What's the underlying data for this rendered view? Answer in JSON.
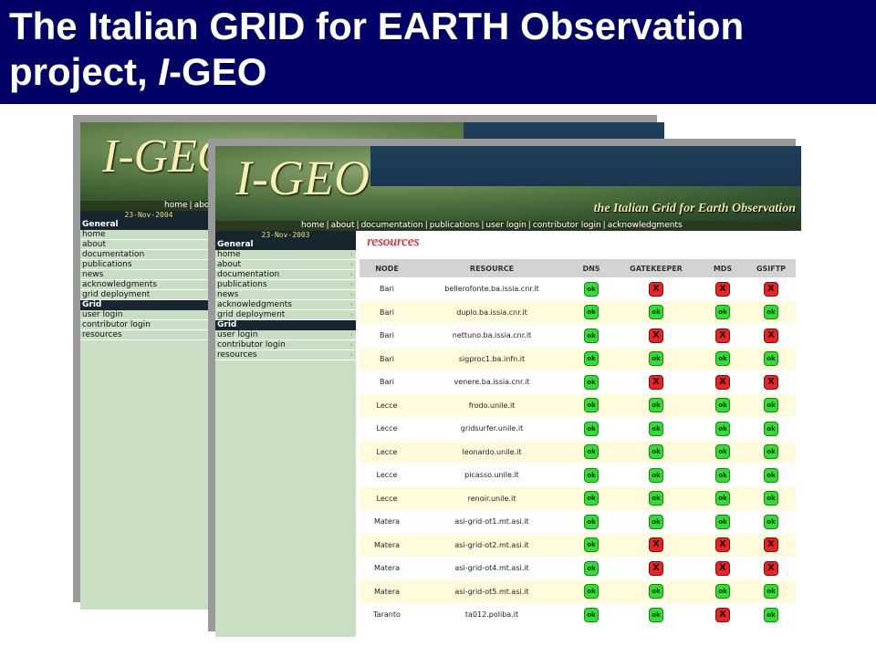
{
  "slide": {
    "title_main": "The Italian GRID for EARTH Observation project, ",
    "title_italic": "I",
    "title_tail": "-GEO"
  },
  "back_window": {
    "logo": "I-GEO",
    "nav": [
      "home",
      "abo"
    ],
    "date": "23-Nov-2004",
    "sections": [
      {
        "head": "General",
        "items": [
          "home",
          "about",
          "documentation",
          "publications",
          "news",
          "acknowledgments",
          "grid deployment"
        ]
      },
      {
        "head": "Grid",
        "items": [
          "user login",
          "contributor login",
          "resources"
        ]
      }
    ]
  },
  "front_window": {
    "logo": "I-GEO",
    "tagline": "the Italian Grid for Earth Observation",
    "nav": [
      "home",
      "about",
      "documentation",
      "publications",
      "user login",
      "contributor login",
      "acknowledgments"
    ],
    "date": "23-Nov-2003",
    "sections": [
      {
        "head": "General",
        "items": [
          "home",
          "about",
          "documentation",
          "publications",
          "news",
          "acknowledgments",
          "grid deployment"
        ]
      },
      {
        "head": "Grid",
        "items": [
          "user login",
          "contributor login",
          "resources"
        ]
      }
    ],
    "resources_title": "resources",
    "table": {
      "columns": [
        "NODE",
        "RESOURCE",
        "DNS",
        "GATEKEEPER",
        "MDS",
        "GSIFTP"
      ],
      "ok_label": "ok",
      "ko_label": "X",
      "rows": [
        {
          "node": "Bari",
          "resource": "bellerofonte.ba.issia.cnr.it",
          "status": [
            "ok",
            "ko",
            "ko",
            "ko"
          ]
        },
        {
          "node": "Bari",
          "resource": "duplo.ba.issia.cnr.it",
          "status": [
            "ok",
            "ok",
            "ok",
            "ok"
          ]
        },
        {
          "node": "Bari",
          "resource": "nettuno.ba.issia.cnr.it",
          "status": [
            "ok",
            "ko",
            "ko",
            "ko"
          ]
        },
        {
          "node": "Bari",
          "resource": "sigproc1.ba.infn.it",
          "status": [
            "ok",
            "ok",
            "ok",
            "ok"
          ]
        },
        {
          "node": "Bari",
          "resource": "venere.ba.issia.cnr.it",
          "status": [
            "ok",
            "ko",
            "ko",
            "ko"
          ]
        },
        {
          "node": "Lecce",
          "resource": "frodo.unile.it",
          "status": [
            "ok",
            "ok",
            "ok",
            "ok"
          ]
        },
        {
          "node": "Lecce",
          "resource": "gridsurfer.unile.it",
          "status": [
            "ok",
            "ok",
            "ok",
            "ok"
          ]
        },
        {
          "node": "Lecce",
          "resource": "leonardo.unile.it",
          "status": [
            "ok",
            "ok",
            "ok",
            "ok"
          ]
        },
        {
          "node": "Lecce",
          "resource": "picasso.unile.it",
          "status": [
            "ok",
            "ok",
            "ok",
            "ok"
          ]
        },
        {
          "node": "Lecce",
          "resource": "renoir.unile.it",
          "status": [
            "ok",
            "ok",
            "ok",
            "ok"
          ]
        },
        {
          "node": "Matera",
          "resource": "asi-grid-ot1.mt.asi.it",
          "status": [
            "ok",
            "ok",
            "ok",
            "ok"
          ]
        },
        {
          "node": "Matera",
          "resource": "asi-grid-ot2.mt.asi.it",
          "status": [
            "ok",
            "ko",
            "ko",
            "ko"
          ]
        },
        {
          "node": "Matera",
          "resource": "asi-grid-ot4.mt.asi.it",
          "status": [
            "ok",
            "ko",
            "ko",
            "ko"
          ]
        },
        {
          "node": "Matera",
          "resource": "asi-grid-ot5.mt.asi.it",
          "status": [
            "ok",
            "ok",
            "ok",
            "ok"
          ]
        },
        {
          "node": "Taranto",
          "resource": "ta012.poliba.it",
          "status": [
            "ok",
            "ok",
            "ko",
            "ok"
          ]
        }
      ]
    }
  },
  "colors": {
    "title_bg": "#000066",
    "ok": "#33dd33",
    "ko": "#ee2222",
    "sidebar": "#c9dfc4"
  }
}
